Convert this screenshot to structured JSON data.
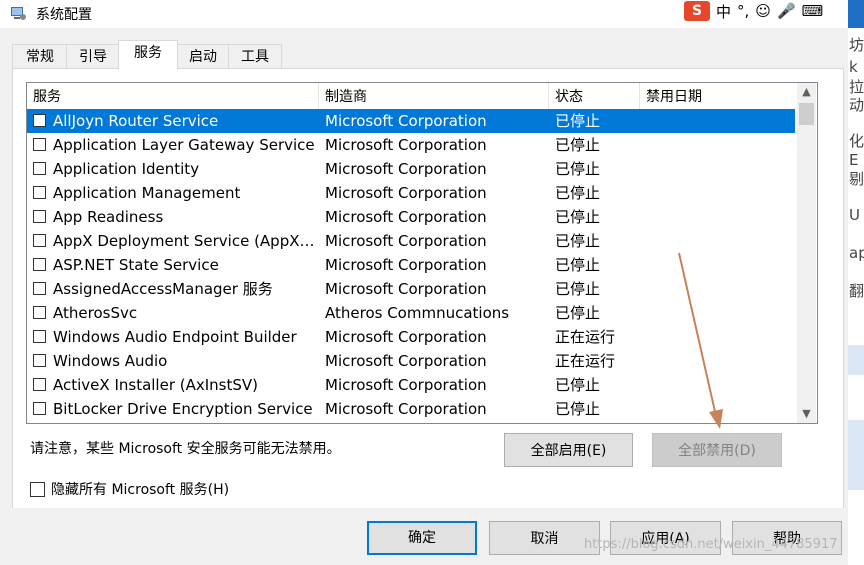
{
  "window": {
    "title": "系统配置"
  },
  "ime": {
    "logo": "S",
    "chars": [
      "中",
      "°,",
      "☺",
      "🎤",
      "⌨"
    ]
  },
  "tabs": [
    {
      "label": "常规",
      "active": false
    },
    {
      "label": "引导",
      "active": false
    },
    {
      "label": "服务",
      "active": true
    },
    {
      "label": "启动",
      "active": false
    },
    {
      "label": "工具",
      "active": false
    }
  ],
  "table": {
    "headers": [
      "服务",
      "制造商",
      "状态",
      "禁用日期"
    ],
    "rows": [
      {
        "name": "AllJoyn Router Service",
        "maker": "Microsoft Corporation",
        "status": "已停止",
        "selected": true
      },
      {
        "name": "Application Layer Gateway Service",
        "maker": "Microsoft Corporation",
        "status": "已停止"
      },
      {
        "name": "Application Identity",
        "maker": "Microsoft Corporation",
        "status": "已停止"
      },
      {
        "name": "Application Management",
        "maker": "Microsoft Corporation",
        "status": "已停止"
      },
      {
        "name": "App Readiness",
        "maker": "Microsoft Corporation",
        "status": "已停止"
      },
      {
        "name": "AppX Deployment Service (AppXS...",
        "maker": "Microsoft Corporation",
        "status": "已停止"
      },
      {
        "name": "ASP.NET State Service",
        "maker": "Microsoft Corporation",
        "status": "已停止"
      },
      {
        "name": "AssignedAccessManager 服务",
        "maker": "Microsoft Corporation",
        "status": "已停止"
      },
      {
        "name": "AtherosSvc",
        "maker": "Atheros Commnucations",
        "status": "已停止"
      },
      {
        "name": "Windows Audio Endpoint Builder",
        "maker": "Microsoft Corporation",
        "status": "正在运行"
      },
      {
        "name": "Windows Audio",
        "maker": "Microsoft Corporation",
        "status": "正在运行"
      },
      {
        "name": "ActiveX Installer (AxInstSV)",
        "maker": "Microsoft Corporation",
        "status": "已停止"
      },
      {
        "name": "BitLocker Drive Encryption Service",
        "maker": "Microsoft Corporation",
        "status": "已停止"
      }
    ]
  },
  "note": "请注意，某些 Microsoft 安全服务可能无法禁用。",
  "buttons": {
    "enable_all": "全部启用(E)",
    "disable_all": "全部禁用(D)",
    "hide_ms": "隐藏所有 Microsoft 服务(H)",
    "ok": "确定",
    "cancel": "取消",
    "apply": "应用(A)",
    "help": "帮助"
  },
  "right_strip_chars": [
    "坊",
    "k拉",
    "动",
    "化E",
    "剔",
    "U",
    "ap",
    "翻"
  ],
  "watermark": "https://blog.csdn.net/weixin_44785917",
  "colors": {
    "selection": "#0078d7",
    "annotation_arrow": "#c8825a"
  }
}
